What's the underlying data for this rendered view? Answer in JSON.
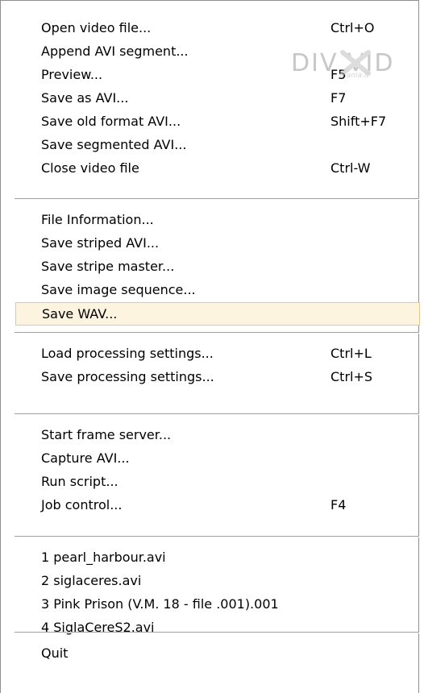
{
  "menu": {
    "groups": [
      {
        "items": [
          {
            "label": "Open video file...",
            "shortcut": "Ctrl+O"
          },
          {
            "label": "Append AVI segment...",
            "shortcut": ""
          },
          {
            "label": "Preview...",
            "shortcut": "F5"
          },
          {
            "label": "Save as AVI...",
            "shortcut": "F7"
          },
          {
            "label": "Save old format AVI...",
            "shortcut": "Shift+F7"
          },
          {
            "label": "Save segmented AVI...",
            "shortcut": ""
          },
          {
            "label": "Close video file",
            "shortcut": "Ctrl-W"
          }
        ]
      },
      {
        "items": [
          {
            "label": "File Information...",
            "shortcut": ""
          },
          {
            "label": "Save striped AVI...",
            "shortcut": ""
          },
          {
            "label": "Save stripe master...",
            "shortcut": ""
          },
          {
            "label": "Save image sequence...",
            "shortcut": ""
          },
          {
            "label": "Save WAV...",
            "shortcut": "",
            "highlighted": true
          }
        ]
      },
      {
        "items": [
          {
            "label": "Load processing settings...",
            "shortcut": "Ctrl+L"
          },
          {
            "label": "Save processing settings...",
            "shortcut": "Ctrl+S"
          }
        ]
      },
      {
        "items": [
          {
            "label": "Start frame server...",
            "shortcut": ""
          },
          {
            "label": "Capture AVI...",
            "shortcut": ""
          },
          {
            "label": "Run script...",
            "shortcut": ""
          },
          {
            "label": "Job control...",
            "shortcut": "F4"
          }
        ]
      },
      {
        "items": [
          {
            "label": "1 pearl_harbour.avi",
            "shortcut": ""
          },
          {
            "label": "2 siglaceres.avi",
            "shortcut": ""
          },
          {
            "label": "3 Pink Prison (V.M. 18 - file .001).001",
            "shortcut": ""
          },
          {
            "label": "4 SiglaCereS2.avi",
            "shortcut": ""
          }
        ]
      },
      {
        "items": [
          {
            "label": "Quit",
            "shortcut": ""
          }
        ]
      }
    ],
    "highlight_color": "#fdf4e0",
    "highlight_border": "#e8c98a"
  },
  "watermark": {
    "text": "DIV  VID",
    "subtext": "mania.it",
    "icon": "divx-logo-icon"
  }
}
